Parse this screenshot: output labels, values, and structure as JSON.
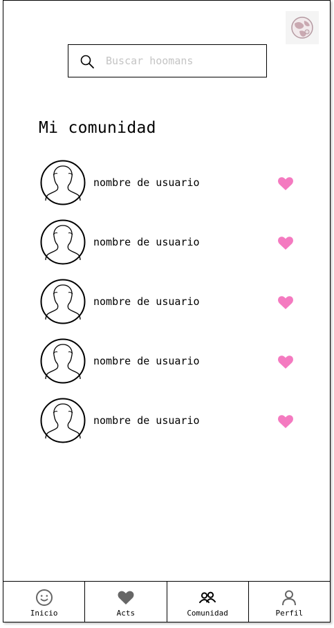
{
  "app": {
    "logo_icon": "globe-pet-logo-icon"
  },
  "search": {
    "placeholder": "Buscar hoomans",
    "value": "",
    "icon": "search-icon"
  },
  "community": {
    "title": "Mi comunidad",
    "heart_color": "#f47ac0",
    "users": [
      {
        "name": "nombre de usuario",
        "liked": true
      },
      {
        "name": "nombre de usuario",
        "liked": true
      },
      {
        "name": "nombre de usuario",
        "liked": true
      },
      {
        "name": "nombre de usuario",
        "liked": true
      },
      {
        "name": "nombre de usuario",
        "liked": true
      }
    ]
  },
  "nav": {
    "items": [
      {
        "label": "Inicio",
        "icon": "smiley-icon",
        "active": false
      },
      {
        "label": "Acts",
        "icon": "heart-icon",
        "active": false
      },
      {
        "label": "Comunidad",
        "icon": "community-icon",
        "active": true
      },
      {
        "label": "Perfil",
        "icon": "person-icon",
        "active": false
      }
    ]
  }
}
